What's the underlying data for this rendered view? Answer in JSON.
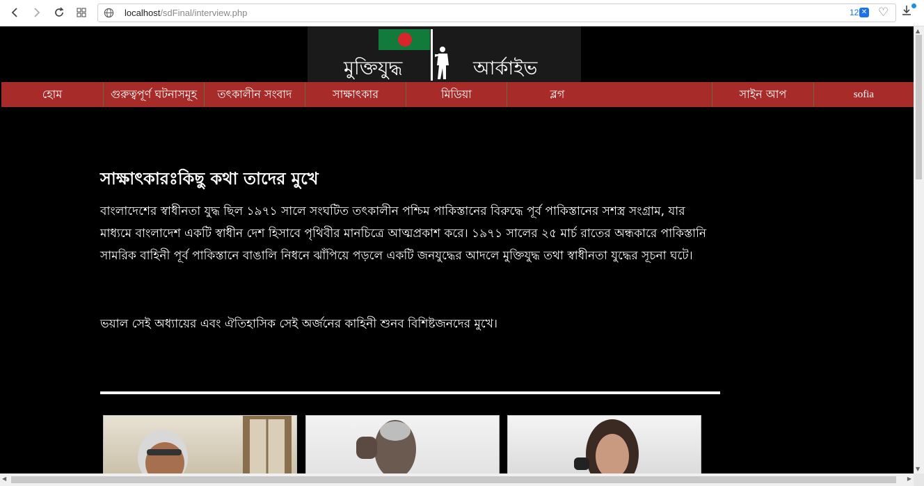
{
  "browser": {
    "url_host": "localhost",
    "url_path": "/sdFinal/interview.php",
    "badge_count": "12"
  },
  "logo": {
    "text_left": "মুক্তিযুদ্ধ",
    "text_right": "আর্কাইভ"
  },
  "menu": {
    "items": [
      "হোম",
      "গুরুত্বপূর্ণ ঘটনাসমূহ",
      "তৎকালীন সংবাদ",
      "সাক্ষাৎকার",
      "মিডিয়া",
      "ব্লগ",
      "সাইন আপ",
      "sofia"
    ]
  },
  "content": {
    "heading": "সাক্ষাৎকারঃকিছু কথা তাদের মুখে",
    "para1": "বাংলাদেশের স্বাধীনতা যুদ্ধ ছিল ১৯৭১ সালে সংঘটিত তৎকালীন পশ্চিম পাকিস্তানের বিরুদ্ধে পূর্ব পাকিস্তানের সশস্ত্র সংগ্রাম, যার মাধ্যমে বাংলাদেশ একটি স্বাধীন দেশ হিসাবে পৃথিবীর মানচিত্রে আত্মপ্রকাশ করে। ১৯৭১ সালের ২৫ মার্চ রাতের অন্ধকারে পাকিস্তানি সামরিক বাহিনী পূর্ব পাকিস্তানে বাঙালি নিধনে ঝাঁপিয়ে পড়লে একটি জনযুদ্ধের আদলে মুক্তিযুদ্ধ তথা স্বাধীনতা যুদ্ধের সূচনা ঘটে।",
    "para2": "ভয়াল সেই অধ্যায়ের এবং ঐতিহাসিক সেই অর্জনের কাহিনী শুনব বিশিষ্টজনদের মুখে।"
  },
  "colors": {
    "menu_bg": "#a72b28",
    "page_bg": "#000000"
  }
}
